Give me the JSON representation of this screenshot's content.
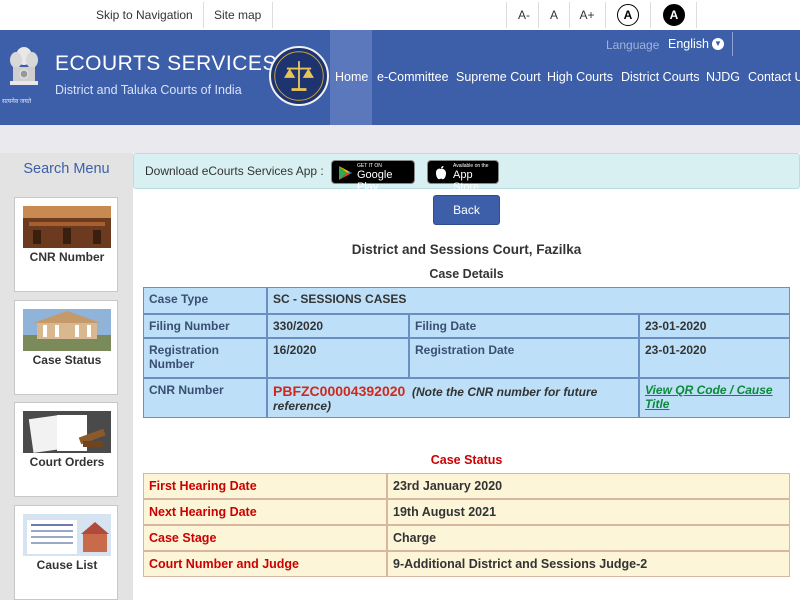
{
  "topbar": {
    "skip_nav": "Skip to Navigation",
    "sitemap": "Site map",
    "font_decrease": "A-",
    "font_normal": "A",
    "font_increase": "A+",
    "contrast_normal": "A",
    "contrast_dark": "A"
  },
  "header": {
    "emblem_motto": "सत्यमेव जयते",
    "title": "ECOURTS SERVICES",
    "subtitle": "District and Taluka Courts of India",
    "language_label": "Language",
    "language_value": "English",
    "nav": [
      "Home",
      "e-Committee",
      "Supreme Court",
      "High Courts",
      "District Courts",
      "NJDG",
      "Contact U"
    ]
  },
  "sidebar": {
    "title": "Search Menu",
    "items": [
      "CNR Number",
      "Case Status",
      "Court Orders",
      "Cause List"
    ]
  },
  "appbar": {
    "text": "Download eCourts Services App :",
    "google_small": "GET IT ON",
    "google_big": "Google Play",
    "apple_small": "Available on the",
    "apple_big": "App Store"
  },
  "back_label": "Back",
  "court_name": "District and Sessions Court, Fazilka",
  "case_details": {
    "title": "Case Details",
    "case_type_label": "Case Type",
    "case_type": "SC - SESSIONS CASES",
    "filing_number_label": "Filing Number",
    "filing_number": "330/2020",
    "filing_date_label": "Filing Date",
    "filing_date": "23-01-2020",
    "registration_number_label": "Registration Number",
    "registration_number": "16/2020",
    "registration_date_label": "Registration Date",
    "registration_date": "23-01-2020",
    "cnr_label": "CNR Number",
    "cnr_value": "PBFZC00004392020",
    "cnr_note": "(Note the CNR number for future reference)",
    "qr_link": "View QR Code / Cause Title"
  },
  "case_status": {
    "title": "Case Status",
    "rows": [
      {
        "label": "First Hearing Date",
        "value": "23rd January 2020"
      },
      {
        "label": "Next Hearing Date",
        "value": "19th August 2021"
      },
      {
        "label": "Case Stage",
        "value": "Charge"
      },
      {
        "label": "Court Number and Judge",
        "value": "9-Additional District and Sessions Judge-2"
      }
    ]
  },
  "colors": {
    "header_blue": "#3d5faa",
    "details_bg": "#bde0f8",
    "status_bg": "#fcf5d8",
    "status_red": "#cc0000",
    "cnr_red": "#d0281c",
    "link_green": "#0a8a3a"
  }
}
